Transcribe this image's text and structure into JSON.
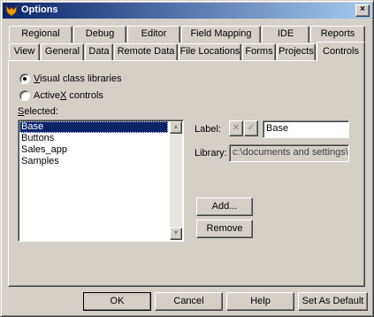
{
  "window": {
    "title": "Options",
    "close_glyph": "×"
  },
  "tabs_row1": [
    {
      "label": "Regional"
    },
    {
      "label": "Debug"
    },
    {
      "label": "Editor"
    },
    {
      "label": "Field Mapping"
    },
    {
      "label": "IDE"
    },
    {
      "label": "Reports"
    }
  ],
  "tabs_row2": [
    {
      "label": "View"
    },
    {
      "label": "General"
    },
    {
      "label": "Data"
    },
    {
      "label": "Remote Data"
    },
    {
      "label": "File Locations"
    },
    {
      "label": "Forms"
    },
    {
      "label": "Projects"
    },
    {
      "label": "Controls",
      "active": true
    }
  ],
  "controls": {
    "radio_visual": {
      "label_pre": "",
      "label_key": "V",
      "label_post": "isual class libraries",
      "checked": true
    },
    "radio_activex": {
      "label_pre": "Active",
      "label_key": "X",
      "label_post": " controls",
      "checked": false
    },
    "selected_label_key": "S",
    "selected_label_post": "elected:",
    "list_items": [
      "Base",
      "Buttons",
      "Sales_app",
      "Samples"
    ],
    "label_caption": "Label:",
    "label_value": "Base",
    "library_caption": "Library:",
    "library_value": "c:\\documents and settings\\tara",
    "add_button": "Add...",
    "remove_button": "Remove",
    "cancel_icon": "cross-icon",
    "confirm_icon": "check-icon"
  },
  "footer": {
    "ok": "OK",
    "cancel": "Cancel",
    "help": "Help",
    "set_default": "Set As Default"
  }
}
